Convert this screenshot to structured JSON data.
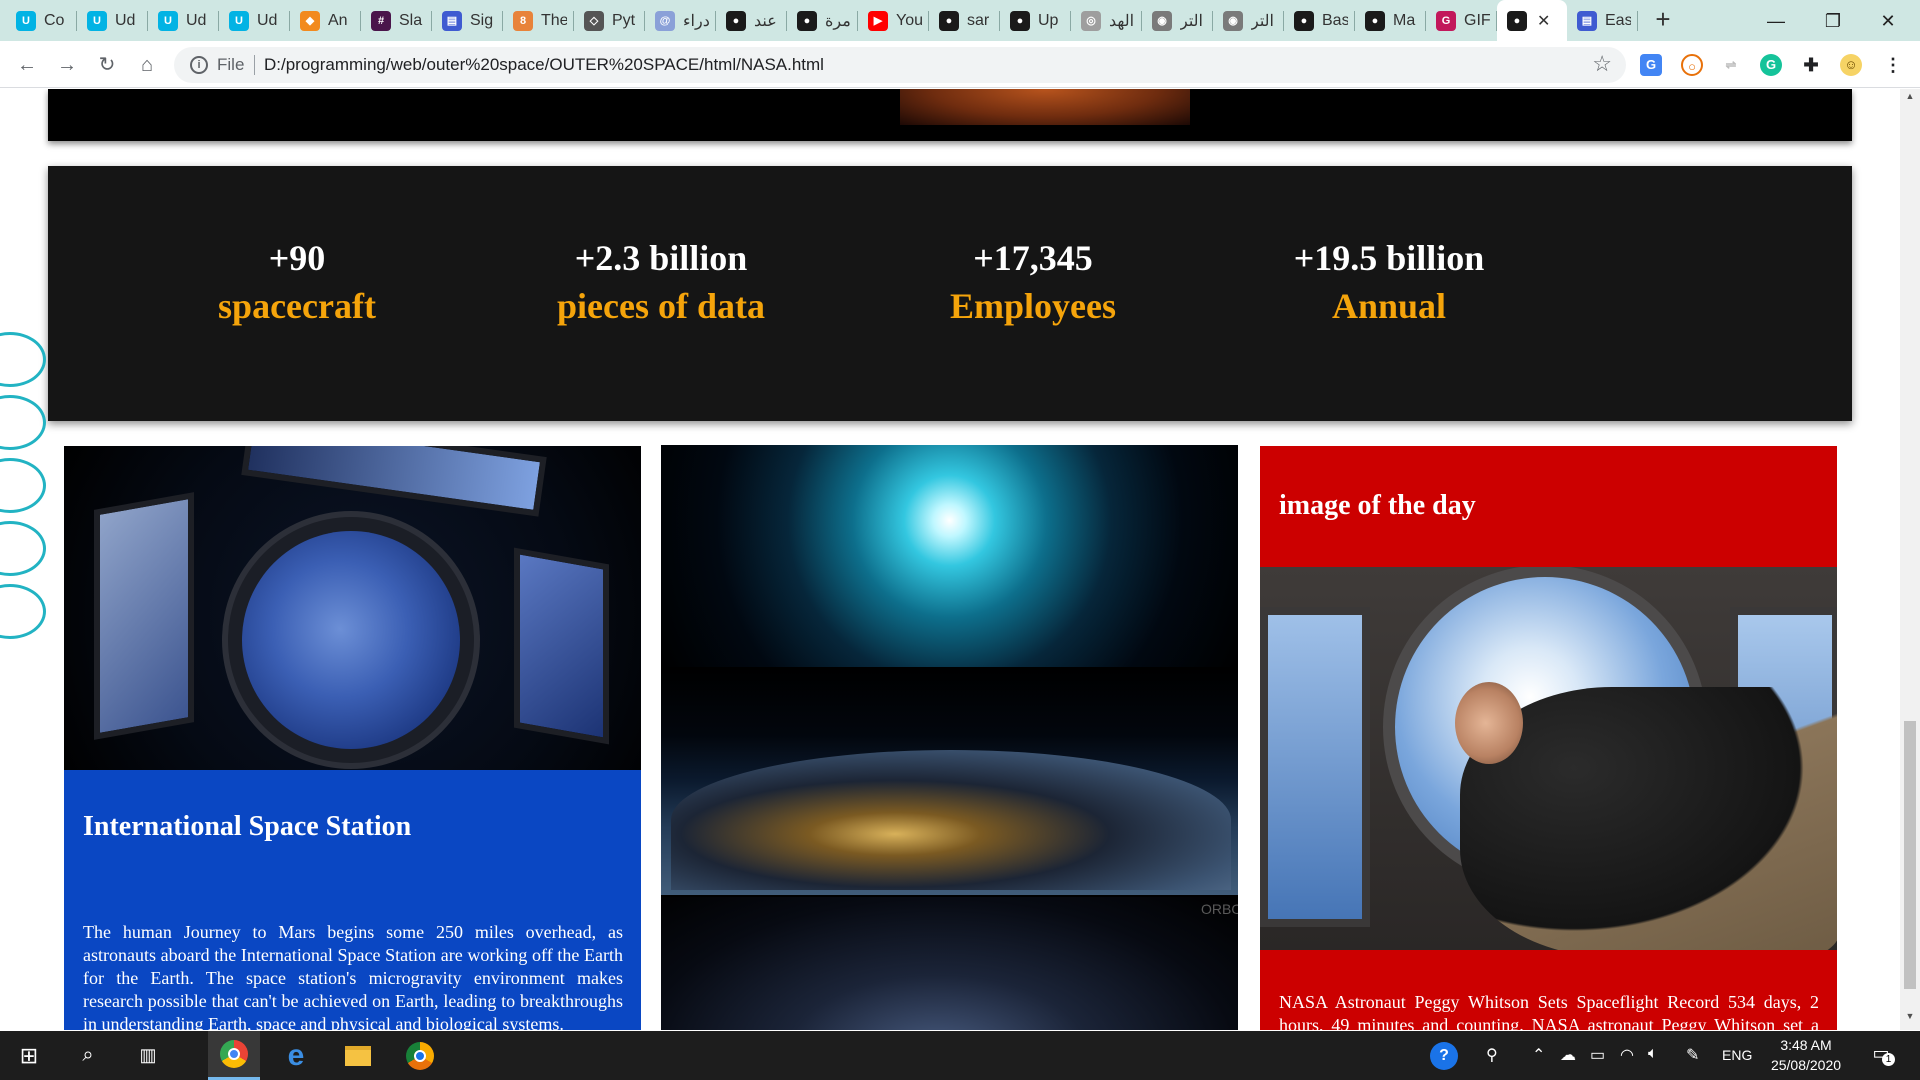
{
  "browser": {
    "tabs": [
      {
        "label": "Co",
        "icon": "udacity-icon",
        "color": "#02b3e4",
        "glyph": "U"
      },
      {
        "label": "Ud",
        "icon": "udacity-icon",
        "color": "#02b3e4",
        "glyph": "U"
      },
      {
        "label": "Ud",
        "icon": "udacity-icon",
        "color": "#02b3e4",
        "glyph": "U"
      },
      {
        "label": "Ud",
        "icon": "udacity-icon",
        "color": "#02b3e4",
        "glyph": "U"
      },
      {
        "label": "An",
        "icon": "cube-icon",
        "color": "#f28a1e",
        "glyph": "◆"
      },
      {
        "label": "Sla",
        "icon": "slack-icon",
        "color": "#4a154b",
        "glyph": "#"
      },
      {
        "label": "Sig",
        "icon": "doc-icon",
        "color": "#3f5bd1",
        "glyph": "▤"
      },
      {
        "label": "The",
        "icon": "pin-icon",
        "color": "#e8833a",
        "glyph": "8"
      },
      {
        "label": "Pyt",
        "icon": "diamond-icon",
        "color": "#555555",
        "glyph": "◇"
      },
      {
        "label": "دراء",
        "icon": "spiral-icon",
        "color": "#8aa0d8",
        "glyph": "@"
      },
      {
        "label": "عند",
        "icon": "globe-icon",
        "color": "#1a1a1a",
        "glyph": "●"
      },
      {
        "label": "مرة",
        "icon": "globe-icon",
        "color": "#1a1a1a",
        "glyph": "●"
      },
      {
        "label": "You",
        "icon": "youtube-icon",
        "color": "#ff0000",
        "glyph": "▶"
      },
      {
        "label": "sar",
        "icon": "github-icon",
        "color": "#1a1a1a",
        "glyph": "●"
      },
      {
        "label": "Up",
        "icon": "github-icon",
        "color": "#1a1a1a",
        "glyph": "●"
      },
      {
        "label": "الهد",
        "icon": "planet-icon",
        "color": "#9e9e9e",
        "glyph": "◎"
      },
      {
        "label": "التر",
        "icon": "target-icon",
        "color": "#7a7a7a",
        "glyph": "◉"
      },
      {
        "label": "التر",
        "icon": "target-icon",
        "color": "#7a7a7a",
        "glyph": "◉"
      },
      {
        "label": "Bas",
        "icon": "github-icon",
        "color": "#1a1a1a",
        "glyph": "●"
      },
      {
        "label": "Ma",
        "icon": "github-icon",
        "color": "#1a1a1a",
        "glyph": "●"
      },
      {
        "label": "GIF",
        "icon": "gif-icon",
        "color": "#c2185b",
        "glyph": "G"
      },
      {
        "label": "",
        "icon": "globe-icon",
        "color": "#1a1a1a",
        "glyph": "●",
        "active": true
      },
      {
        "label": "Eas",
        "icon": "doc-icon",
        "color": "#3f5bd1",
        "glyph": "▤"
      }
    ],
    "address": {
      "scheme_label": "File",
      "url": "D:/programming/web/outer%20space/OUTER%20SPACE/html/NASA.html"
    }
  },
  "stats": [
    {
      "number": "+90",
      "label": "spacecraft"
    },
    {
      "number": "+2.3 billion",
      "label": "pieces of data"
    },
    {
      "number": "+17,345",
      "label": "Employees"
    },
    {
      "number": "+19.5 billion",
      "label": "Annual"
    }
  ],
  "cards": {
    "iss": {
      "title": "International Space Station",
      "body": "The human Journey to Mars begins some 250 miles overhead, as astronauts aboard the International Space Station are working off the Earth for the Earth. The space station's microgravity environment makes research possible that can't be achieved on Earth, leading to breakthroughs in understanding Earth, space and physical and biological systems."
    },
    "video": {
      "watermark": "ORBO"
    },
    "image_of_day": {
      "title": "image of the day",
      "body": "NASA Astronaut Peggy Whitson Sets Spaceflight Record 534 days, 2 hours, 49 minutes and counting. NASA astronaut Peggy Whitson set a new record for most cumulative days in space by a U.S. astronaut."
    }
  },
  "taskbar": {
    "language": "ENG",
    "time": "3:48 AM",
    "date": "25/08/2020",
    "notification_count": "1"
  },
  "colors": {
    "stat_label": "#f5a40b",
    "iss_card": "#0a47c3",
    "iod_card": "#cc0000",
    "side_dots": "#22b3c3"
  }
}
